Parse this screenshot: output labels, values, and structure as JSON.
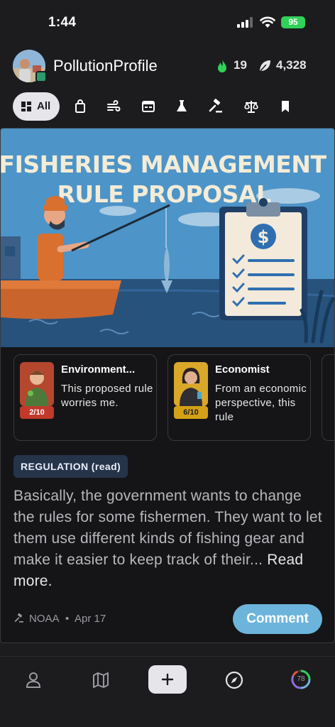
{
  "status_bar": {
    "time": "1:44",
    "battery": "95"
  },
  "header": {
    "username": "PollutionProfile",
    "streak_count": "19",
    "points_count": "4,328"
  },
  "filters": {
    "all_label": "All",
    "tabs": [
      "shopping-bag-icon",
      "wind-icon",
      "calendar-icon",
      "flask-icon",
      "gavel-icon",
      "scale-icon",
      "bookmark-icon"
    ]
  },
  "card": {
    "hero_title_line1": "FISHERIES MANAGEMENT",
    "hero_title_line2": "RULE PROPOSAL",
    "hero_symbol": "$",
    "personas": [
      {
        "name": "Environment...",
        "score": "2/10",
        "text": "This proposed rule worries me."
      },
      {
        "name": "Economist",
        "score": "6/10",
        "text": "From an economic perspective, this rule"
      }
    ],
    "tag": "REGULATION (read)",
    "summary": "Basically, the government wants to change the rules for some fishermen. They want to let them use different kinds of fishing gear and make it easier to keep track of their...",
    "read_more": "Read more.",
    "agency": "NOAA",
    "separator": "•",
    "date": "Apr 17",
    "comment_label": "Comment"
  },
  "bottom_nav": {
    "progress_value": "78"
  },
  "colors": {
    "accent": "#6cb4db",
    "streak": "#30d158",
    "score_low": "#c0392b",
    "score_mid": "#d4a017",
    "tag_bg": "#26344a"
  }
}
